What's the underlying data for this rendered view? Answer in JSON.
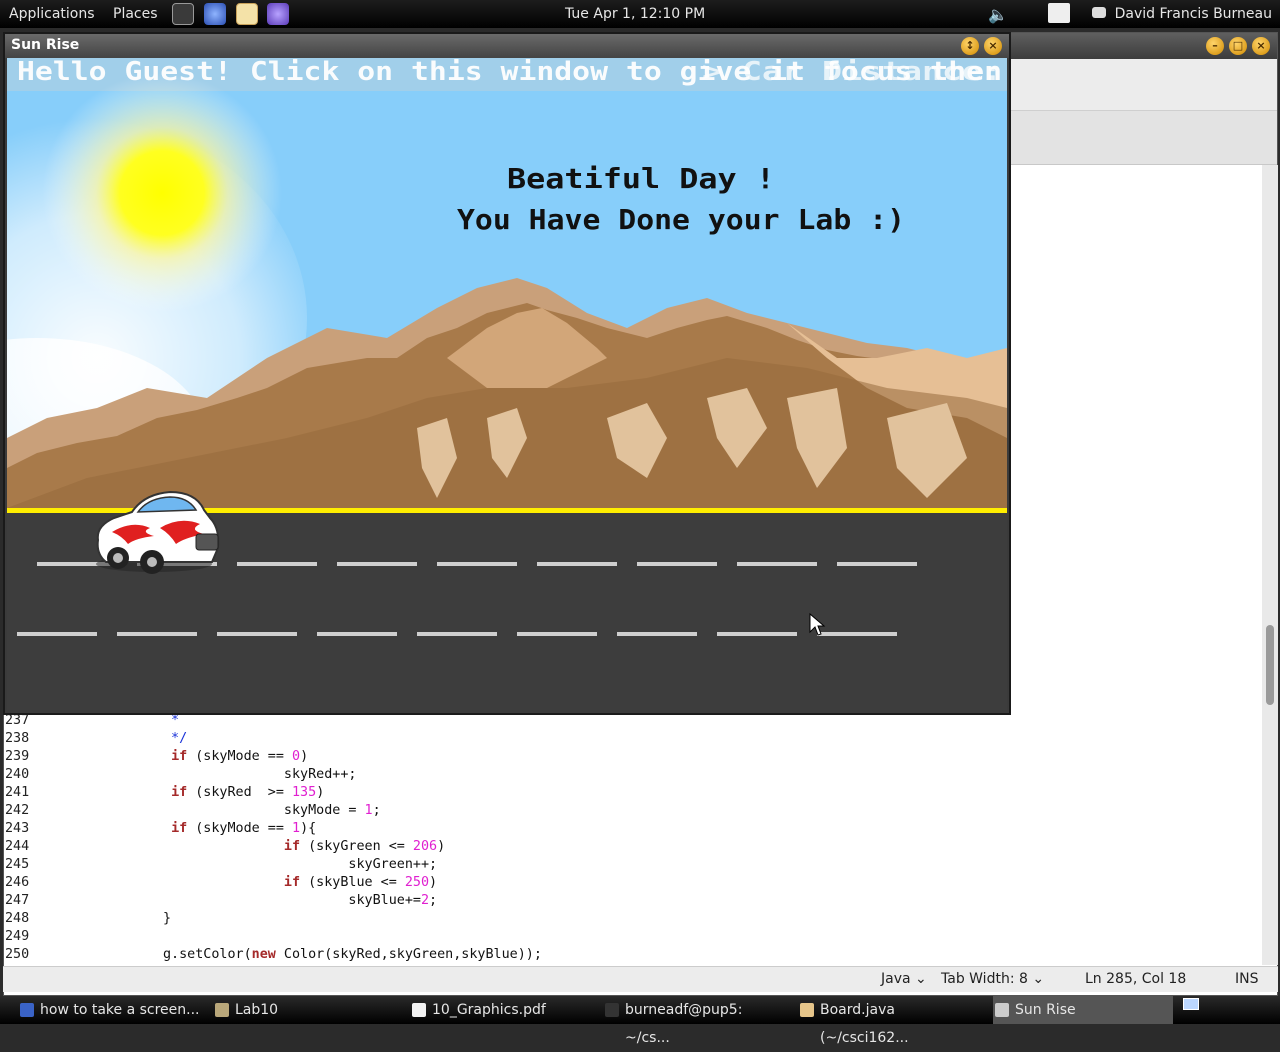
{
  "top_panel": {
    "applications": "Applications",
    "places": "Places",
    "clock": "Tue Apr  1, 12:10 PM",
    "user": "David Francis Burneau"
  },
  "sunrise_window": {
    "title": "Sun Rise",
    "banner_left": "Hello Guest! Click on this window to give it focus then",
    "banner_right": "> Car Distance: ",
    "message_line1": "Beatiful Day !",
    "message_line2": "You Have Done your Lab :)"
  },
  "editor": {
    "code_lines": [
      {
        "num": "237",
        "segs": [
          {
            "t": "                 *",
            "c": "cmt"
          }
        ]
      },
      {
        "num": "238",
        "segs": [
          {
            "t": "                 */",
            "c": "cmt"
          }
        ]
      },
      {
        "num": "239",
        "segs": [
          {
            "t": "                 ",
            "c": "plain"
          },
          {
            "t": "if",
            "c": "kw"
          },
          {
            "t": " (skyMode == ",
            "c": "plain"
          },
          {
            "t": "0",
            "c": "num"
          },
          {
            "t": ")",
            "c": "plain"
          }
        ]
      },
      {
        "num": "240",
        "segs": [
          {
            "t": "                               skyRed++;",
            "c": "plain"
          }
        ]
      },
      {
        "num": "241",
        "segs": [
          {
            "t": "                 ",
            "c": "plain"
          },
          {
            "t": "if",
            "c": "kw"
          },
          {
            "t": " (skyRed  >= ",
            "c": "plain"
          },
          {
            "t": "135",
            "c": "num"
          },
          {
            "t": ")",
            "c": "plain"
          }
        ]
      },
      {
        "num": "242",
        "segs": [
          {
            "t": "                               skyMode = ",
            "c": "plain"
          },
          {
            "t": "1",
            "c": "num"
          },
          {
            "t": ";",
            "c": "plain"
          }
        ]
      },
      {
        "num": "243",
        "segs": [
          {
            "t": "                 ",
            "c": "plain"
          },
          {
            "t": "if",
            "c": "kw"
          },
          {
            "t": " (skyMode == ",
            "c": "plain"
          },
          {
            "t": "1",
            "c": "num"
          },
          {
            "t": "){",
            "c": "plain"
          }
        ]
      },
      {
        "num": "244",
        "segs": [
          {
            "t": "                               ",
            "c": "plain"
          },
          {
            "t": "if",
            "c": "kw"
          },
          {
            "t": " (skyGreen <= ",
            "c": "plain"
          },
          {
            "t": "206",
            "c": "num"
          },
          {
            "t": ")",
            "c": "plain"
          }
        ]
      },
      {
        "num": "245",
        "segs": [
          {
            "t": "                                       skyGreen++;",
            "c": "plain"
          }
        ]
      },
      {
        "num": "246",
        "segs": [
          {
            "t": "                               ",
            "c": "plain"
          },
          {
            "t": "if",
            "c": "kw"
          },
          {
            "t": " (skyBlue <= ",
            "c": "plain"
          },
          {
            "t": "250",
            "c": "num"
          },
          {
            "t": ")",
            "c": "plain"
          }
        ]
      },
      {
        "num": "247",
        "segs": [
          {
            "t": "                                       skyBlue+=",
            "c": "plain"
          },
          {
            "t": "2",
            "c": "num"
          },
          {
            "t": ";",
            "c": "plain"
          }
        ]
      },
      {
        "num": "248",
        "segs": [
          {
            "t": "                }",
            "c": "plain"
          }
        ]
      },
      {
        "num": "249",
        "segs": [
          {
            "t": "",
            "c": "plain"
          }
        ]
      },
      {
        "num": "250",
        "segs": [
          {
            "t": "                g.setColor(",
            "c": "plain"
          },
          {
            "t": "new",
            "c": "kw"
          },
          {
            "t": " Color(skyRed,skyGreen,skyBlue));",
            "c": "plain"
          }
        ]
      }
    ],
    "status": {
      "language": "Java ⌄",
      "tab_width": "Tab Width:  8 ⌄",
      "position": "Ln 285, Col 18",
      "mode": "INS"
    }
  },
  "taskbar": {
    "items": [
      {
        "label": "how to take a screen...",
        "icon": "browser-icon",
        "color": "#3a63c7"
      },
      {
        "label": "Lab10",
        "icon": "folder-icon",
        "color": "#b9a77a"
      },
      {
        "label": "10_Graphics.pdf",
        "icon": "pdf-icon",
        "color": "#f2f2f2"
      },
      {
        "label": "burneadf@pup5: ~/cs...",
        "icon": "terminal-icon",
        "color": "#333333"
      },
      {
        "label": "Board.java (~/csci162...",
        "icon": "text-editor-icon",
        "color": "#e6c58a"
      },
      {
        "label": "Sun Rise",
        "icon": "java-app-icon",
        "color": "#cccccc",
        "active": true
      }
    ]
  },
  "colors": {
    "sky": "#87cefa",
    "road": "#3d3d3d",
    "road_edge": "#ffee00",
    "lane_marks": "#cfcfcf"
  }
}
